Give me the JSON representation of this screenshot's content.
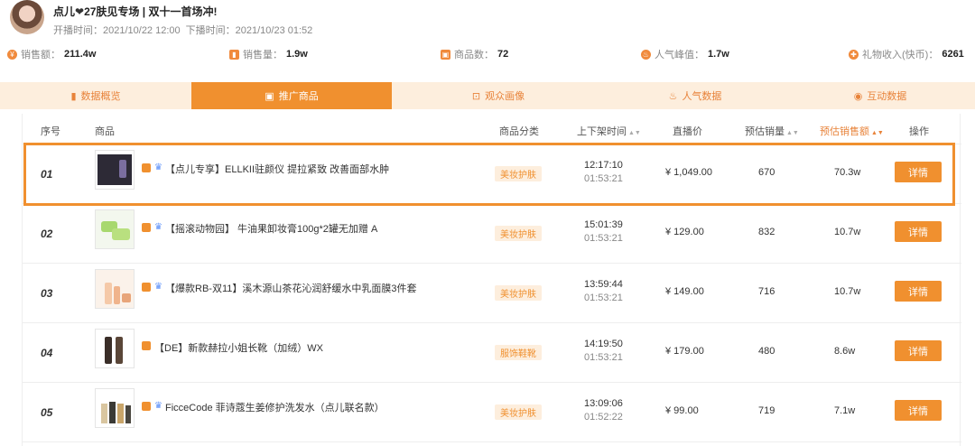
{
  "header": {
    "title_part1": "点儿",
    "title_heart": "❤",
    "title_part2": "27肤见专场 | 双十一首场冲!",
    "start_label": "开播时间：",
    "start_time": "2021/10/22 12:00",
    "end_label": "下播时间：",
    "end_time": "2021/10/23 01:52"
  },
  "stats": [
    {
      "label": "销售额：",
      "value": "211.4w",
      "icon": "coin-icon"
    },
    {
      "label": "销售量：",
      "value": "1.9w",
      "icon": "bar-chart-icon"
    },
    {
      "label": "商品数：",
      "value": "72",
      "icon": "bag-icon"
    },
    {
      "label": "人气峰值：",
      "value": "1.7w",
      "icon": "fire-icon"
    },
    {
      "label": "礼物收入(快币)：",
      "value": "6261",
      "icon": "gift-icon"
    }
  ],
  "tabs": [
    {
      "label": "数据概览",
      "icon": "bar-chart-icon",
      "glyph": "▮"
    },
    {
      "label": "推广商品",
      "icon": "bag-icon",
      "glyph": "▣"
    },
    {
      "label": "观众画像",
      "icon": "scan-face-icon",
      "glyph": "⊡"
    },
    {
      "label": "人气数据",
      "icon": "fire-icon",
      "glyph": "♨"
    },
    {
      "label": "互动数据",
      "icon": "chat-icon",
      "glyph": "◉"
    }
  ],
  "table": {
    "columns": {
      "no": "序号",
      "product": "商品",
      "category": "商品分类",
      "time": "上下架时间",
      "price": "直播价",
      "sales": "预估销量",
      "amount": "预估销售额",
      "action": "操作"
    },
    "rows": [
      {
        "no": "01",
        "name": "【点儿专享】ELLKII驻颜仪 提拉紧致 改善面部水肿",
        "has_blue_tag": true,
        "category": "美妆护肤",
        "up": "12:17:10",
        "down": "01:53:21",
        "price": "¥ 1,049.00",
        "sales": "670",
        "amount": "70.3w",
        "action": "详情",
        "thumb": "device"
      },
      {
        "no": "02",
        "name": "【摇滚动物园】 牛油果卸妆膏100g*2罐无加赠 A",
        "has_blue_tag": true,
        "category": "美妆护肤",
        "up": "15:01:39",
        "down": "01:53:21",
        "price": "¥ 129.00",
        "sales": "832",
        "amount": "10.7w",
        "action": "详情",
        "thumb": "green"
      },
      {
        "no": "03",
        "name": "【爆款RB-双11】溪木源山茶花沁润舒缓水中乳面膜3件套",
        "has_blue_tag": true,
        "category": "美妆护肤",
        "up": "13:59:44",
        "down": "01:53:21",
        "price": "¥ 149.00",
        "sales": "716",
        "amount": "10.7w",
        "action": "详情",
        "thumb": "peach"
      },
      {
        "no": "04",
        "name": "【DE】新款赫拉小姐长靴（加绒）WX",
        "has_blue_tag": false,
        "category": "服饰鞋靴",
        "up": "14:19:50",
        "down": "01:53:21",
        "price": "¥ 179.00",
        "sales": "480",
        "amount": "8.6w",
        "action": "详情",
        "thumb": "boots"
      },
      {
        "no": "05",
        "name": "FicceCode 菲诗蔻生姜修护洗发水（点儿联名款）",
        "has_blue_tag": true,
        "category": "美妆护肤",
        "up": "13:09:06",
        "down": "01:52:22",
        "price": "¥ 99.00",
        "sales": "719",
        "amount": "7.1w",
        "action": "详情",
        "thumb": "bottles"
      }
    ]
  },
  "colors": {
    "accent": "#f0902f",
    "tab_bg": "#fdeedd",
    "highlight": "#f0902f"
  }
}
